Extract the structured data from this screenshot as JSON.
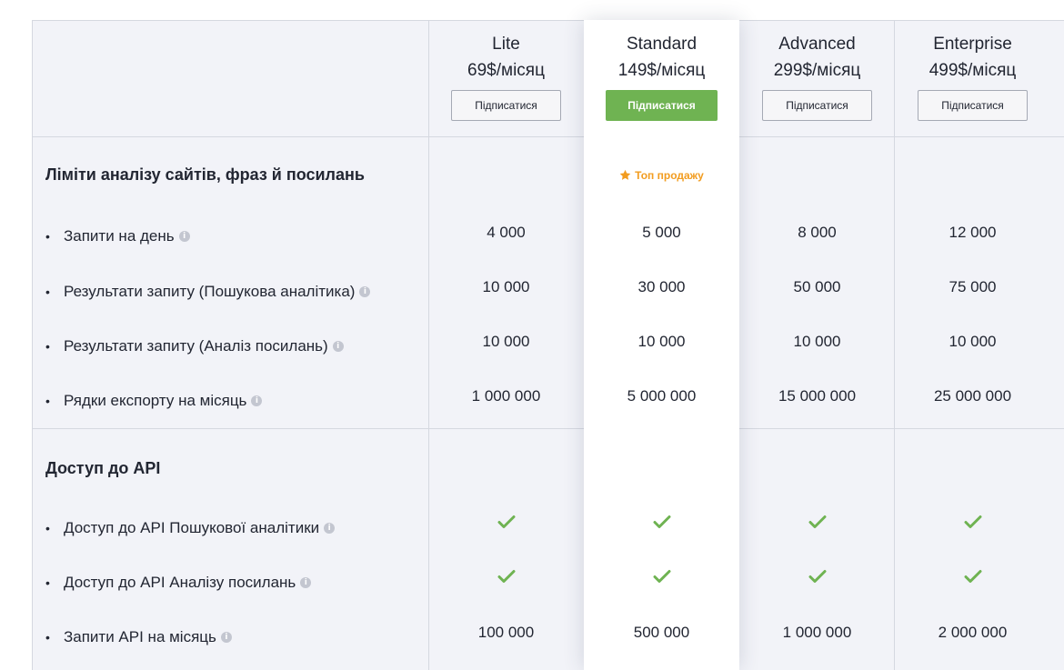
{
  "plans": [
    {
      "name": "Lite",
      "price": "69$/місяц",
      "button": "Підписатися"
    },
    {
      "name": "Standard",
      "price": "149$/місяц",
      "button": "Підписатися"
    },
    {
      "name": "Advanced",
      "price": "299$/місяц",
      "button": "Підписатися"
    },
    {
      "name": "Enterprise",
      "price": "499$/місяц",
      "button": "Підписатися"
    }
  ],
  "highlight_badge": "Топ продажу",
  "sections": [
    {
      "title": "Ліміти аналізу сайтів, фраз й посилань",
      "rows": [
        {
          "label": "Запити на день",
          "values": [
            "4 000",
            "5 000",
            "8 000",
            "12 000"
          ]
        },
        {
          "label": "Результати запиту (Пошукова аналітика)",
          "values": [
            "10 000",
            "30 000",
            "50 000",
            "75 000"
          ]
        },
        {
          "label": "Результати запиту (Аналіз посилань)",
          "values": [
            "10 000",
            "10 000",
            "10 000",
            "10 000"
          ]
        },
        {
          "label": "Рядки експорту на місяць",
          "values": [
            "1 000 000",
            "5 000 000",
            "15 000 000",
            "25 000 000"
          ]
        }
      ]
    },
    {
      "title": "Доступ до API",
      "rows": [
        {
          "label": "Доступ до API Пошукової аналітики",
          "values": [
            "check",
            "check",
            "check",
            "check"
          ]
        },
        {
          "label": "Доступ до API Аналізу посилань",
          "values": [
            "check",
            "check",
            "check",
            "check"
          ]
        },
        {
          "label": "Запити API на місяць",
          "values": [
            "100 000",
            "500 000",
            "1 000 000",
            "2 000 000"
          ]
        }
      ]
    }
  ],
  "icons": {
    "info": "info-icon",
    "check": "check-icon",
    "star": "star-icon"
  },
  "colors": {
    "primary_button": "#6fb352",
    "check": "#6fb352",
    "badge": "#f29c1f",
    "table_bg": "#f2f3f8",
    "highlight_bg": "#ffffff"
  }
}
